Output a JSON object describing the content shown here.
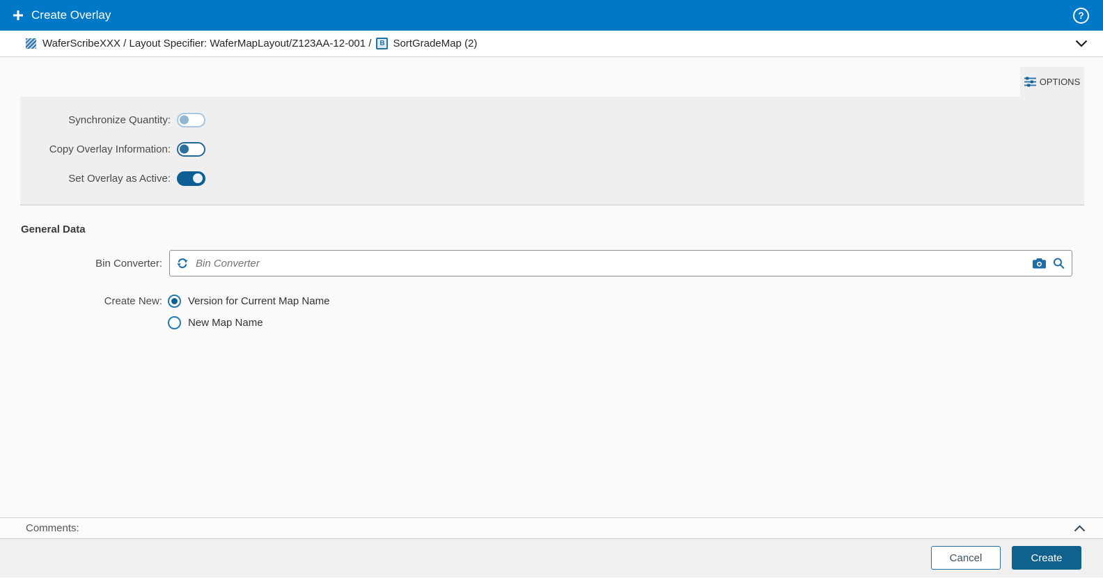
{
  "header": {
    "title": "Create Overlay",
    "help_glyph": "?"
  },
  "breadcrumb": {
    "segment1": "WaferScribeXXX / Layout Specifier: WaferMapLayout/Z123AA-12-001 /",
    "map_type_letter": "B",
    "segment2": "SortGradeMap (2)"
  },
  "options_panel": {
    "button_label": "OPTIONS",
    "toggles": [
      {
        "label": "Synchronize Quantity:",
        "state": "off",
        "disabled": true
      },
      {
        "label": "Copy Overlay Information:",
        "state": "off",
        "disabled": false
      },
      {
        "label": "Set Overlay as Active:",
        "state": "on",
        "disabled": false
      }
    ]
  },
  "general_data": {
    "section_title": "General Data",
    "bin_converter": {
      "label": "Bin Converter:",
      "value": "",
      "placeholder": "Bin Converter"
    },
    "create_new": {
      "label": "Create New:",
      "options": [
        {
          "label": "Version for Current Map Name",
          "selected": true
        },
        {
          "label": "New Map Name",
          "selected": false
        }
      ]
    }
  },
  "comments": {
    "label": "Comments:"
  },
  "footer": {
    "cancel_label": "Cancel",
    "create_label": "Create"
  },
  "colors": {
    "header_bg": "#0078c8",
    "accent_blue": "#1c6ea4",
    "dark_blue": "#0d5e92",
    "panel_bg": "#efefef",
    "footer_bg": "#f0f0f0"
  }
}
